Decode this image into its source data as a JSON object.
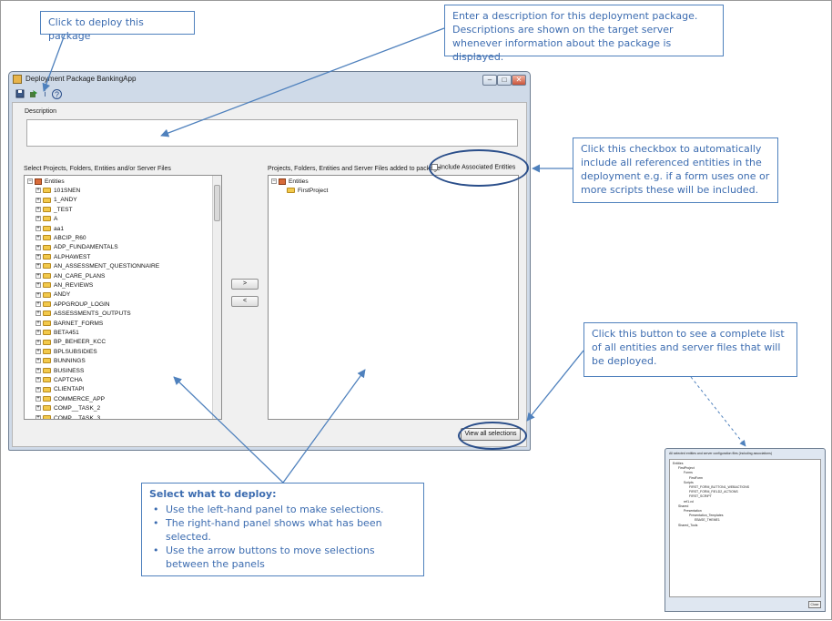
{
  "callouts": {
    "deploy": "Click to deploy this package",
    "description": "Enter a description for this deployment package. Descriptions are shown on the target server whenever information about the package is displayed.",
    "include": "Click this checkbox to automatically include all referenced entities in the deployment e.g. if a form uses one or more scripts these will be included.",
    "view_all": "Click this button to see a complete list of all entities and server files that will be deployed.",
    "select": {
      "title": "Select what to deploy:",
      "bullets": [
        "Use the left-hand panel to make selections.",
        "The right-hand panel shows what has been selected.",
        "Use the arrow buttons to move selections between the panels"
      ]
    }
  },
  "window": {
    "title": "Deployment Package BankingApp",
    "toolbar": {
      "help_icon": "?",
      "info_icon": "i"
    },
    "description_label": "Description",
    "left_label": "Select Projects, Folders, Entities and/or Server Files",
    "right_label": "Projects, Folders, Entities and Server Files added to package",
    "include_label": "Include Associated Entities",
    "add_button": ">",
    "remove_button": "<",
    "view_all_button": "View all selections",
    "left_tree": {
      "root": "Entities",
      "items": [
        "101SNEN",
        "1_ANDY",
        "_TEST",
        "A",
        "aa1",
        "ABCIP_R60",
        "ADP_FUNDAMENTALS",
        "ALPHAWEST",
        "AN_ASSESSMENT_QUESTIONNAIRE",
        "AN_CARE_PLANS",
        "AN_REVIEWS",
        "ANDY",
        "APPGROUP_LOGIN",
        "ASSESSMENTS_OUTPUTS",
        "BARNET_FORMS",
        "BETA451",
        "BP_BEHEER_KCC",
        "BPLSUBSIDIES",
        "BUNNINGS",
        "BUSINESS",
        "CAPTCHA",
        "CLIENTAPI",
        "COMMERCE_APP",
        "COMP__TASK_2",
        "COMP__TASK_3"
      ]
    },
    "right_tree": {
      "root": "Entities",
      "items": [
        "FirstProject"
      ]
    }
  },
  "thumbnail": {
    "title": "All selected entities and server configuration files (including associations)",
    "rows": [
      "Entities",
      "FirstProject",
      "Forms",
      "FirstForm",
      "Scripts",
      "FIRST_FORM_BUTTON1_WEBACTIONS",
      "FIRST_FORM_FIELD2_ACTIONS",
      "FIRST_SCRIPT",
      "ref1.vd",
      "Shared",
      "Presentation",
      "Presentation_Templates",
      "EBASE_THEME1",
      "Shared_Tools"
    ],
    "close_button": "Close"
  }
}
